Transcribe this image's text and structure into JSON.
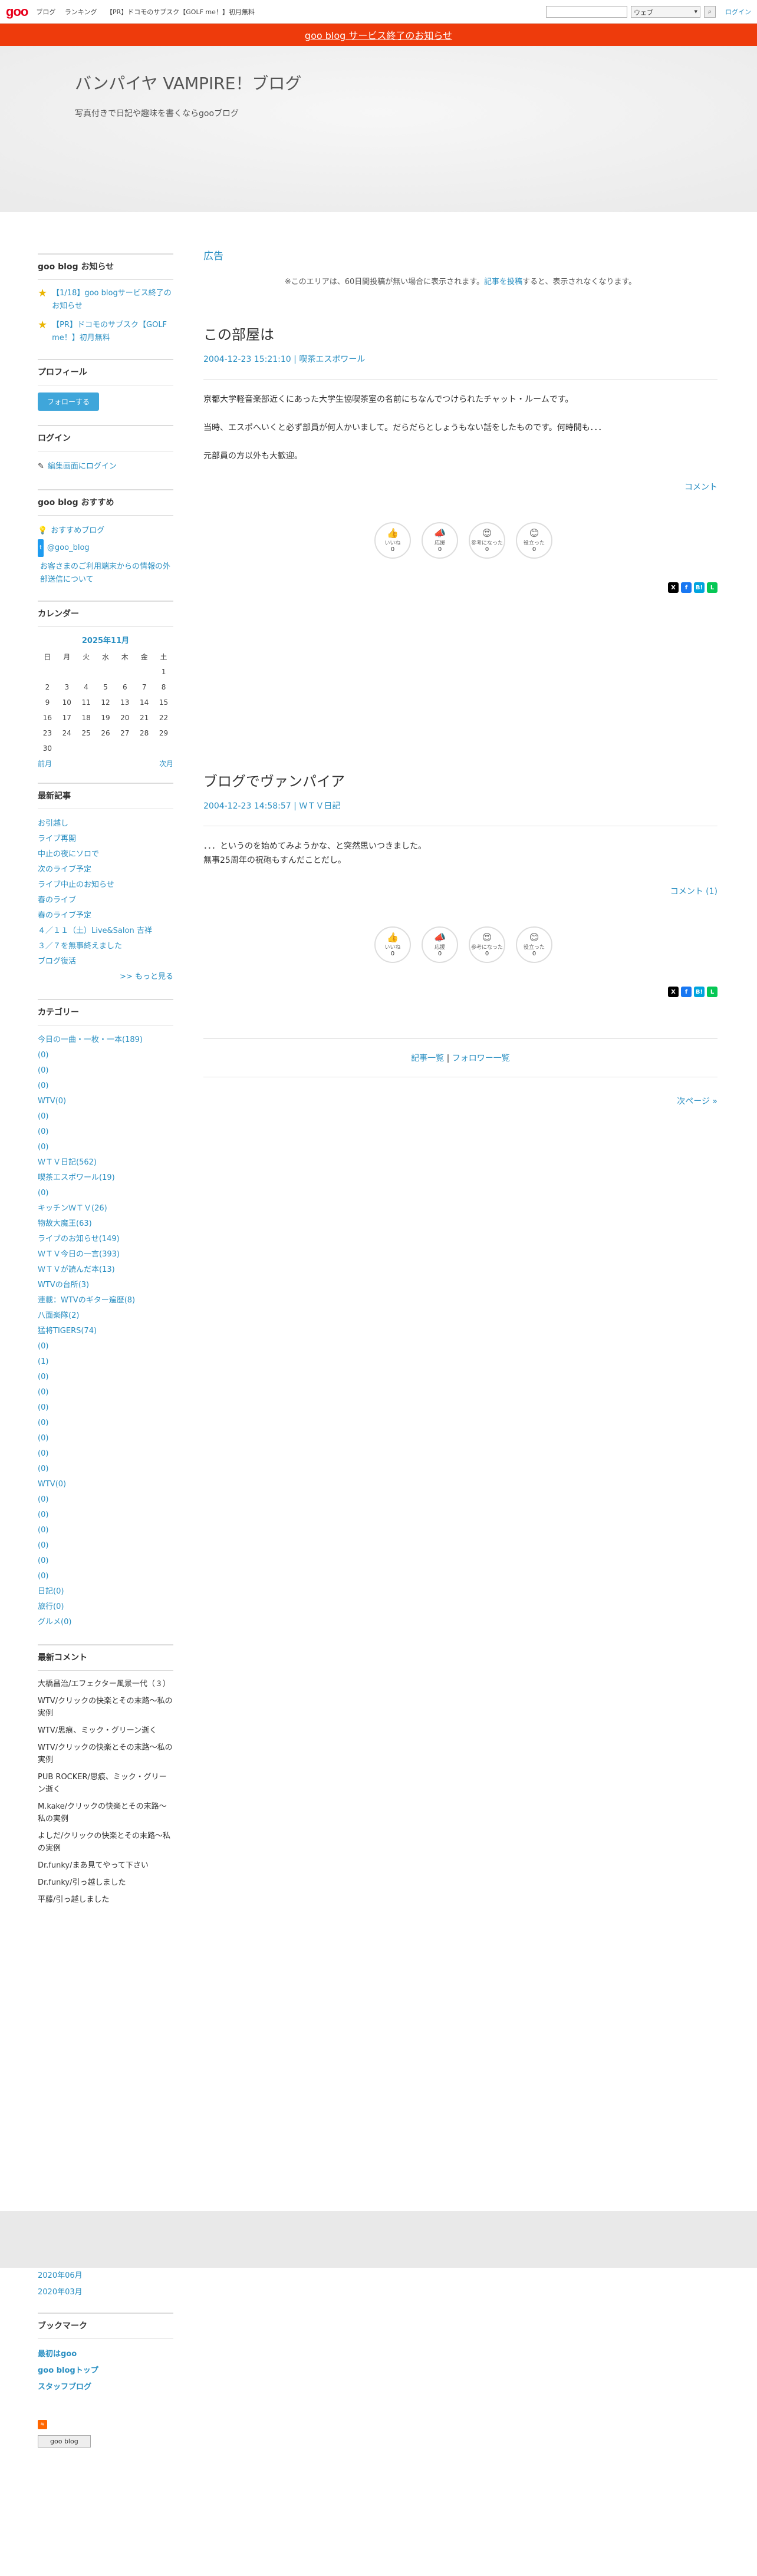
{
  "topbar": {
    "logo": "goo",
    "nav": [
      "ブログ",
      "ランキング",
      "【PR】ドコモのサブスク【GOLF me！】初月無料"
    ],
    "search_select": "ウェブ",
    "login": "ログイン"
  },
  "notice": "goo blog サービス終了のお知らせ",
  "blog": {
    "title": "バンパイヤ VAMPIRE！ブログ",
    "description": "写真付きで日記や趣味を書くならgooブログ"
  },
  "sidebar": {
    "news_title": "goo blog お知らせ",
    "news": [
      "【1/18】goo blogサービス終了のお知らせ",
      "【PR】ドコモのサブスク【GOLF me！】初月無料"
    ],
    "profile_title": "プロフィール",
    "follow_label": "フォローする",
    "login_title": "ログイン",
    "edit_login": "編集画面にログイン",
    "recommend_title": "goo blog おすすめ",
    "recommend": [
      "おすすめブログ",
      "@goo_blog",
      "お客さまのご利用端末からの情報の外部送信について"
    ],
    "calendar_title": "カレンダー",
    "calendar_month": "2025年11月",
    "weekdays": [
      "日",
      "月",
      "火",
      "水",
      "木",
      "金",
      "土"
    ],
    "weeks": [
      [
        "",
        "",
        "",
        "",
        "",
        "",
        "1"
      ],
      [
        "2",
        "3",
        "4",
        "5",
        "6",
        "7",
        "8"
      ],
      [
        "9",
        "10",
        "11",
        "12",
        "13",
        "14",
        "15"
      ],
      [
        "16",
        "17",
        "18",
        "19",
        "20",
        "21",
        "22"
      ],
      [
        "23",
        "24",
        "25",
        "26",
        "27",
        "28",
        "29"
      ],
      [
        "30",
        "",
        "",
        "",
        "",
        "",
        ""
      ]
    ],
    "cal_prev": "前月",
    "cal_next": "次月",
    "recent_title": "最新記事",
    "recent": [
      "お引越し",
      "ライブ再開",
      "中止の夜にソロで",
      "次のライブ予定",
      "ライブ中止のお知らせ",
      "春のライブ",
      "春のライブ予定",
      "４／１１（土）Live&Salon 吉祥",
      "３／７を無事終えました",
      "ブログ復活"
    ],
    "more": ">> もっと見る",
    "category_title": "カテゴリー",
    "categories": [
      "今日の一曲・一枚・一本(189)",
      "(0)",
      "(0)",
      "(0)",
      "WTV(0)",
      "(0)",
      "(0)",
      "(0)",
      "ＷＴＶ日記(562)",
      "喫茶エスポワール(19)",
      "(0)",
      "キッチンＷＴＶ(26)",
      "物故大魔王(63)",
      "ライブのお知らせ(149)",
      "ＷＴＶ今日の一言(393)",
      "ＷＴＶが読んだ本(13)",
      "WTVの台所(3)",
      "連載：WTVのギター遍歴(8)",
      "八面楽隊(2)",
      "猛将TIGERS(74)",
      "(0)",
      "(1)",
      "(0)",
      "(0)",
      "(0)",
      "(0)",
      "(0)",
      "(0)",
      "(0)",
      "WTV(0)",
      "(0)",
      "(0)",
      "(0)",
      "(0)",
      "(0)",
      "(0)",
      "日記(0)",
      "旅行(0)",
      "グルメ(0)"
    ],
    "comments_title": "最新コメント",
    "comments": [
      "大橋昌治/エフェクター風景一代（３）",
      "WTV/クリックの快楽とその末路～私の実例",
      "WTV/思痕、ミック・グリーン逝く",
      "WTV/クリックの快楽とその末路～私の実例",
      "PUB ROCKER/思痕、ミック・グリーン逝く",
      "M.kake/クリックの快楽とその末路～私の実例",
      "よしだ/クリックの快楽とその末路～私の実例",
      "Dr.funky/まあ見てやって下さい",
      "Dr.funky/引っ越しました",
      "平藤/引っ越しました"
    ],
    "archives": [
      "2020年06月",
      "2020年03月"
    ],
    "bookmark_title": "ブックマーク",
    "bookmarks": [
      "最初はgoo",
      "goo blogトップ",
      "スタッフブログ"
    ],
    "badge": "goo blog"
  },
  "main": {
    "ad_label": "広告",
    "ad_note_pre": "※このエリアは、60日間投稿が無い場合に表示されます。",
    "ad_note_link": "記事を投稿",
    "ad_note_post": "すると、表示されなくなります。",
    "entries": [
      {
        "title": "この部屋は",
        "date": "2004-12-23 15:21:10",
        "category": "喫茶エスポワール",
        "paragraphs": [
          "京都大学軽音楽部近くにあった大学生協喫茶室の名前にちなんでつけられたチャット・ルームです。",
          "当時、エスポへいくと必ず部員が何人かいまして。だらだらとしょうもない話をしたものです。何時間も．．．",
          "元部員の方以外も大歓迎。"
        ],
        "comment": "コメント"
      },
      {
        "title": "ブログでヴァンパイア",
        "date": "2004-12-23 14:58:57",
        "category": "ＷＴＶ日記",
        "paragraphs": [
          "．．．というのを始めてみようかな、と突然思いつきました。\n無事25周年の祝砲もすんだことだし。"
        ],
        "comment": "コメント (1)"
      }
    ],
    "reactions": [
      {
        "label": "いいね",
        "emoji": "👍",
        "count": "0"
      },
      {
        "label": "応援",
        "emoji": "📣",
        "count": "0"
      },
      {
        "label": "参考になった",
        "emoji": "😍",
        "count": "0"
      },
      {
        "label": "役立った",
        "emoji": "😊",
        "count": "0"
      }
    ],
    "pager_articles": "記事一覧",
    "pager_sep": "|",
    "pager_follow": "フォロワー一覧",
    "next_page": "次ページ »"
  }
}
